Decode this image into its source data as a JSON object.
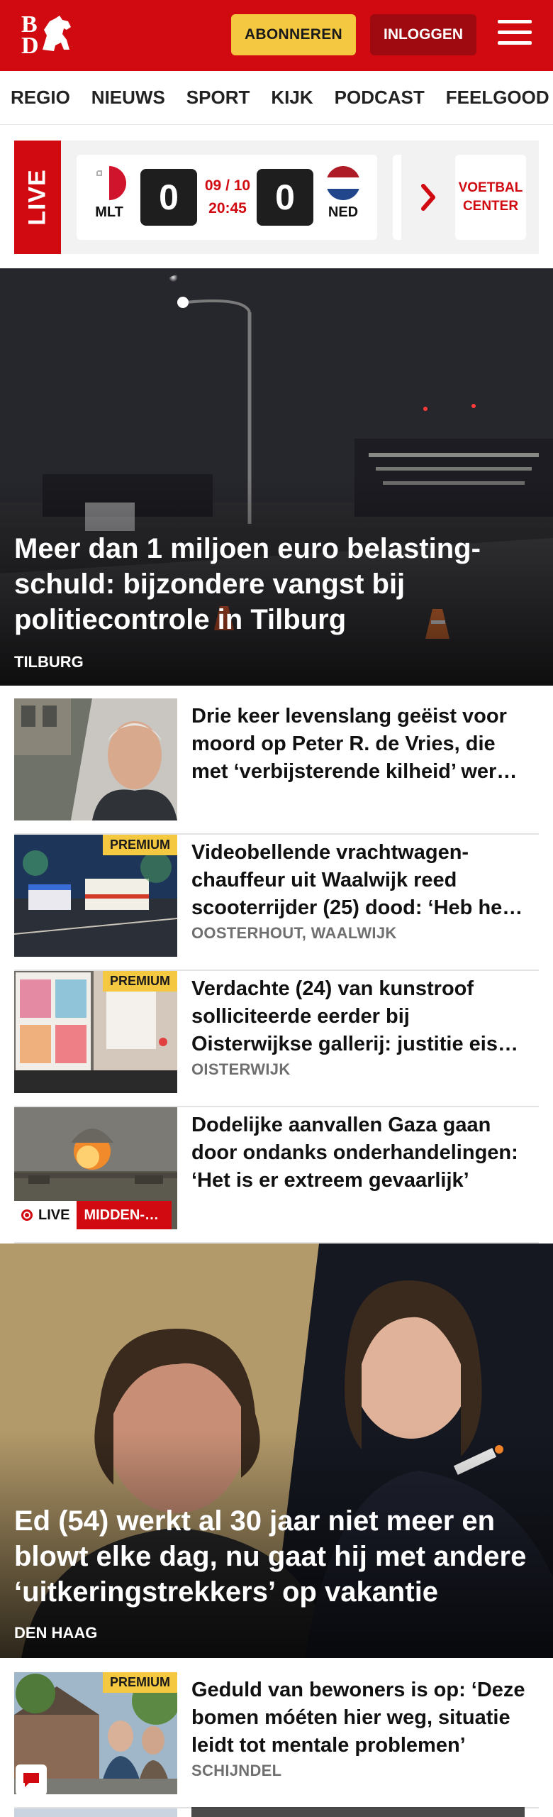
{
  "header": {
    "logo_top": "B",
    "logo_bottom": "D",
    "subscribe_label": "ABONNEREN",
    "login_label": "INLOGGEN",
    "brand_color": "#d10a11",
    "accent_color": "#f5c842"
  },
  "nav": {
    "items": [
      {
        "label": "REGIO"
      },
      {
        "label": "NIEUWS"
      },
      {
        "label": "SPORT"
      },
      {
        "label": "KIJK"
      },
      {
        "label": "PODCAST"
      },
      {
        "label": "FEELGOOD"
      }
    ]
  },
  "live": {
    "label": "LIVE",
    "match": {
      "home_code": "MLT",
      "away_code": "NED",
      "home_score": "0",
      "away_score": "0",
      "date": "09 / 10",
      "time": "20:45"
    },
    "voetbal_center_label": "VOETBAL\nCENTER"
  },
  "hero": {
    "title": "Meer dan 1 miljoen euro belasting-schuld: bijzondere vangst bij politiecontrole in Tilburg",
    "tag": "TILBURG"
  },
  "articles": [
    {
      "title": "Drie keer levenslang geëist voor moord op Peter R. de Vries, die met ‘verbijsterende kilheid’ wer…",
      "tag": "",
      "premium": false
    },
    {
      "title": "Videobellende vrachtwagen-chauffeur uit Waalwijk reed scooterrijder (25) dood: ‘Heb he…",
      "tag": "OOSTERHOUT, WAALWIJK",
      "premium": true,
      "premium_label": "PREMIUM"
    },
    {
      "title": "Verdachte (24) van kunstroof solliciteerde eerder bij Oisterwijkse gallerij: justitie eis…",
      "tag": "OISTERWIJK",
      "premium": true,
      "premium_label": "PREMIUM"
    },
    {
      "title": "Dodelijke aanvallen Gaza gaan door ondanks onderhandelingen: ‘Het is er extreem gevaarlijk’",
      "tag": "",
      "premium": false,
      "live_label": "LIVE",
      "section_label": "MIDDEN-…"
    }
  ],
  "hero2": {
    "title": "Ed (54) werkt al 30 jaar niet meer en blowt elke dag, nu gaat hij met andere ‘uitkeringstrekkers’ op vakantie",
    "tag": "DEN HAAG"
  },
  "article5": {
    "title": "Geduld van bewoners is op: ‘Deze bomen móéten hier weg, situatie leidt tot mentale problemen’",
    "tag": "SCHIJNDEL",
    "premium_label": "PREMIUM"
  },
  "icons": {
    "menu": "hamburger-icon",
    "next": "chevron-right-icon",
    "chat": "chat-bubble-icon"
  }
}
